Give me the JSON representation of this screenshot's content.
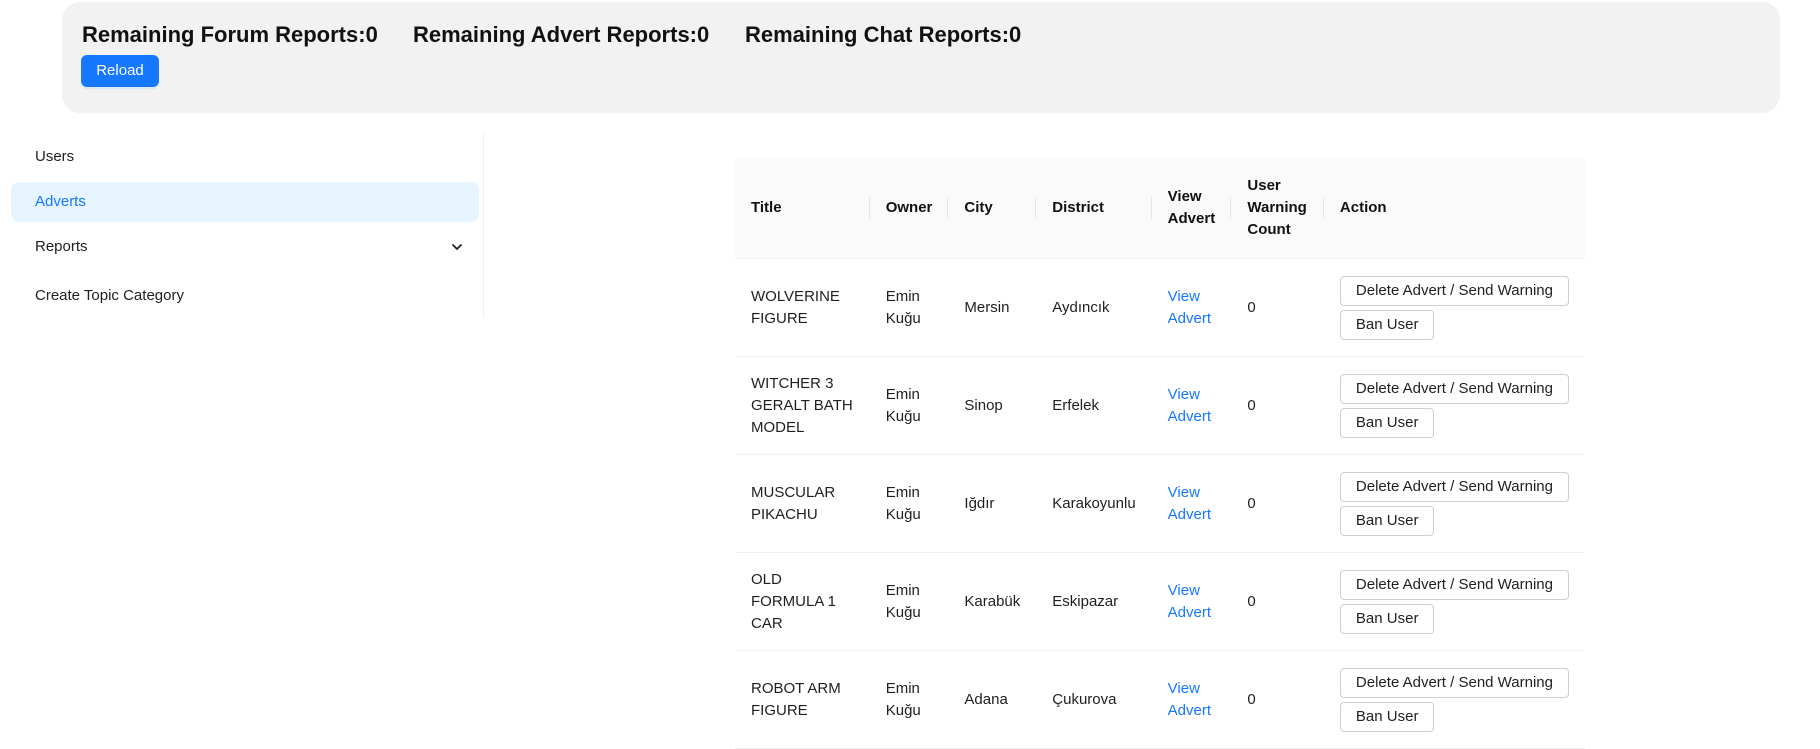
{
  "stats": {
    "forum": "Remaining Forum Reports:0",
    "advert": "Remaining Advert Reports:0",
    "chat": "Remaining Chat Reports:0",
    "reload_label": "Reload"
  },
  "sidebar": {
    "items": [
      {
        "label": "Users"
      },
      {
        "label": "Adverts"
      },
      {
        "label": "Reports"
      },
      {
        "label": "Create Topic Category"
      }
    ]
  },
  "table": {
    "columns": [
      "Title",
      "Owner",
      "City",
      "District",
      "View Advert",
      "User Warning Count",
      "Action"
    ],
    "rows": [
      {
        "title": "WOLVERINE FIGURE",
        "owner": "Emin Kuğu",
        "city": "Mersin",
        "district": "Aydıncık",
        "view": "View Advert",
        "warnings": "0",
        "delete_label": "Delete Advert / Send Warning",
        "ban_label": "Ban User"
      },
      {
        "title": "WITCHER 3 GERALT BATH MODEL",
        "owner": "Emin Kuğu",
        "city": "Sinop",
        "district": "Erfelek",
        "view": "View Advert",
        "warnings": "0",
        "delete_label": "Delete Advert / Send Warning",
        "ban_label": "Ban User"
      },
      {
        "title": "MUSCULAR PIKACHU",
        "owner": "Emin Kuğu",
        "city": "Iğdır",
        "district": "Karakoyunlu",
        "view": "View Advert",
        "warnings": "0",
        "delete_label": "Delete Advert / Send Warning",
        "ban_label": "Ban User"
      },
      {
        "title": "OLD FORMULA 1 CAR",
        "owner": "Emin Kuğu",
        "city": "Karabük",
        "district": "Eskipazar",
        "view": "View Advert",
        "warnings": "0",
        "delete_label": "Delete Advert / Send Warning",
        "ban_label": "Ban User"
      },
      {
        "title": "ROBOT ARM FIGURE",
        "owner": "Emin Kuğu",
        "city": "Adana",
        "district": "Çukurova",
        "view": "View Advert",
        "warnings": "0",
        "delete_label": "Delete Advert / Send Warning",
        "ban_label": "Ban User"
      }
    ]
  },
  "colors": {
    "accent": "#1677ff",
    "active_bg": "#e6f4ff",
    "panel_bg": "#f2f2f2",
    "header_bg": "#fafafa"
  },
  "icons": {
    "reports_toggle": "chevron-down-icon"
  }
}
